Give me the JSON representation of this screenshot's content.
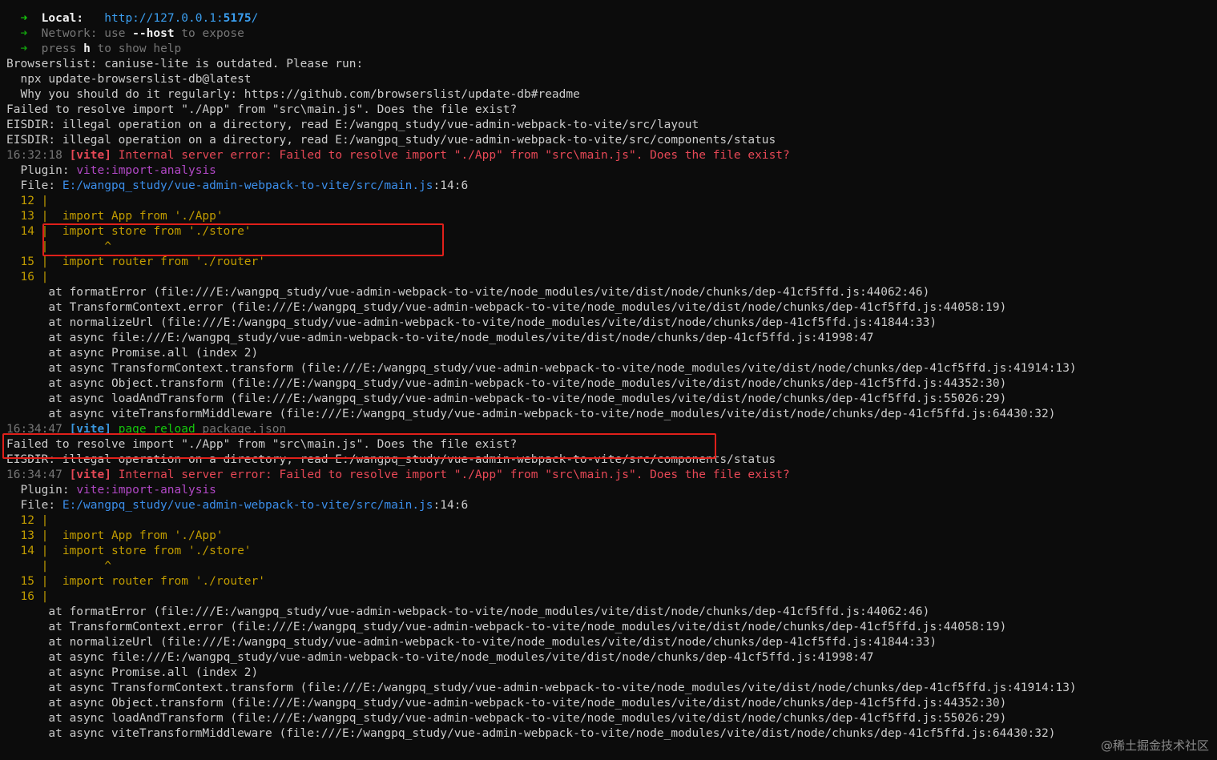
{
  "terminal": {
    "colors": {
      "background": "#0c0c0c",
      "default": "#cccccc",
      "bright_white": "#f2f2f2",
      "green": "#16c60c",
      "url": "#3b9ff0",
      "error_red": "#e74856",
      "timestamp": "#767676",
      "code_yellow": "#c19c00",
      "plugin_magenta": "#b148c6",
      "file_link": "#3b8eea",
      "highlight_box": "#e0201a"
    },
    "lines": [
      {
        "name": "vite-local-line",
        "segs": [
          [
            "  ",
            "c-text"
          ],
          [
            "➜",
            "c-green"
          ],
          [
            "  ",
            "c-text"
          ],
          [
            "Local:",
            "c-white bold"
          ],
          [
            "   ",
            "c-text"
          ],
          [
            "http://127.0.0.1:",
            "c-cyan"
          ],
          [
            "5175",
            "c-cyan bold"
          ],
          [
            "/",
            "c-cyan"
          ]
        ]
      },
      {
        "name": "vite-network-line",
        "segs": [
          [
            "  ",
            "c-text"
          ],
          [
            "➜",
            "c-dgreen"
          ],
          [
            "  ",
            "c-text"
          ],
          [
            "Network:",
            "c-dim"
          ],
          [
            " use ",
            "c-dim"
          ],
          [
            "--host",
            "c-white bold"
          ],
          [
            " to expose",
            "c-dim"
          ]
        ]
      },
      {
        "name": "vite-help-line",
        "segs": [
          [
            "  ",
            "c-text"
          ],
          [
            "➜",
            "c-dgreen"
          ],
          [
            "  ",
            "c-text"
          ],
          [
            "press ",
            "c-dim"
          ],
          [
            "h",
            "c-white bold"
          ],
          [
            " to show help",
            "c-dim"
          ]
        ]
      },
      {
        "name": "browserslist-line",
        "segs": [
          [
            "Browserslist: caniuse-lite is outdated. Please run:",
            "c-text"
          ]
        ]
      },
      {
        "name": "browserslist-cmd-line",
        "segs": [
          [
            "  npx update-browserslist-db@latest",
            "c-text"
          ]
        ]
      },
      {
        "name": "browserslist-why-line",
        "segs": [
          [
            "  Why you should do it regularly: https://github.com/browserslist/update-db#readme",
            "c-text"
          ]
        ]
      },
      {
        "name": "resolve-error-line",
        "segs": [
          [
            "Failed to resolve import \"./App\" from \"src\\main.js\". Does the file exist?",
            "c-text"
          ]
        ]
      },
      {
        "name": "eisdir-layout-line",
        "segs": [
          [
            "EISDIR: illegal operation on a directory, read E:/wangpq_study/vue-admin-webpack-to-vite/src/layout",
            "c-text"
          ]
        ]
      },
      {
        "name": "eisdir-status-line",
        "segs": [
          [
            "EISDIR: illegal operation on a directory, read E:/wangpq_study/vue-admin-webpack-to-vite/src/components/status",
            "c-text"
          ]
        ]
      },
      {
        "name": "internal-error-line",
        "segs": [
          [
            "16:32:18",
            "c-dim"
          ],
          [
            " ",
            "c-text"
          ],
          [
            "[vite]",
            "c-red bold"
          ],
          [
            " Internal server error: Failed to resolve import \"./App\" from \"src\\main.js\". Does the file exist?",
            "c-red"
          ]
        ]
      },
      {
        "name": "plugin-line",
        "segs": [
          [
            "  Plugin: ",
            "c-text"
          ],
          [
            "vite:import-analysis",
            "c-magenta"
          ]
        ]
      },
      {
        "name": "file-line",
        "segs": [
          [
            "  File: ",
            "c-text"
          ],
          [
            "E:/wangpq_study/vue-admin-webpack-to-vite/src/main.js",
            "c-blue"
          ],
          [
            ":14:6",
            "c-text"
          ]
        ]
      },
      {
        "name": "code-frame-line",
        "segs": [
          [
            "  12 |",
            "c-yellow"
          ]
        ]
      },
      {
        "name": "code-frame-line",
        "segs": [
          [
            "  13 |  import App from './App'",
            "c-yellow"
          ]
        ]
      },
      {
        "name": "code-frame-line",
        "segs": [
          [
            "  14 |  import store from './store'",
            "c-yellow"
          ]
        ]
      },
      {
        "name": "code-frame-line",
        "segs": [
          [
            "     |        ^",
            "c-yellow"
          ]
        ]
      },
      {
        "name": "code-frame-line",
        "segs": [
          [
            "  15 |  import router from './router'",
            "c-yellow"
          ]
        ]
      },
      {
        "name": "code-frame-line",
        "segs": [
          [
            "  16 |",
            "c-yellow"
          ]
        ]
      },
      {
        "name": "stack-trace-line",
        "segs": [
          [
            "      at formatError (file:///E:/wangpq_study/vue-admin-webpack-to-vite/node_modules/vite/dist/node/chunks/dep-41cf5ffd.js:44062:46)",
            "c-text"
          ]
        ]
      },
      {
        "name": "stack-trace-line",
        "segs": [
          [
            "      at TransformContext.error (file:///E:/wangpq_study/vue-admin-webpack-to-vite/node_modules/vite/dist/node/chunks/dep-41cf5ffd.js:44058:19)",
            "c-text"
          ]
        ]
      },
      {
        "name": "stack-trace-line",
        "segs": [
          [
            "      at normalizeUrl (file:///E:/wangpq_study/vue-admin-webpack-to-vite/node_modules/vite/dist/node/chunks/dep-41cf5ffd.js:41844:33)",
            "c-text"
          ]
        ]
      },
      {
        "name": "stack-trace-line",
        "segs": [
          [
            "      at async file:///E:/wangpq_study/vue-admin-webpack-to-vite/node_modules/vite/dist/node/chunks/dep-41cf5ffd.js:41998:47",
            "c-text"
          ]
        ]
      },
      {
        "name": "stack-trace-line",
        "segs": [
          [
            "      at async Promise.all (index 2)",
            "c-text"
          ]
        ]
      },
      {
        "name": "stack-trace-line",
        "segs": [
          [
            "      at async TransformContext.transform (file:///E:/wangpq_study/vue-admin-webpack-to-vite/node_modules/vite/dist/node/chunks/dep-41cf5ffd.js:41914:13)",
            "c-text"
          ]
        ]
      },
      {
        "name": "stack-trace-line",
        "segs": [
          [
            "      at async Object.transform (file:///E:/wangpq_study/vue-admin-webpack-to-vite/node_modules/vite/dist/node/chunks/dep-41cf5ffd.js:44352:30)",
            "c-text"
          ]
        ]
      },
      {
        "name": "stack-trace-line",
        "segs": [
          [
            "      at async loadAndTransform (file:///E:/wangpq_study/vue-admin-webpack-to-vite/node_modules/vite/dist/node/chunks/dep-41cf5ffd.js:55026:29)",
            "c-text"
          ]
        ]
      },
      {
        "name": "stack-trace-line",
        "segs": [
          [
            "      at async viteTransformMiddleware (file:///E:/wangpq_study/vue-admin-webpack-to-vite/node_modules/vite/dist/node/chunks/dep-41cf5ffd.js:64430:32)",
            "c-text"
          ]
        ]
      },
      {
        "name": "page-reload-line",
        "segs": [
          [
            "16:34:47",
            "c-dim"
          ],
          [
            " ",
            "c-text"
          ],
          [
            "[vite]",
            "c-teal bold"
          ],
          [
            " ",
            "c-text"
          ],
          [
            "page reload",
            "c-lgreen"
          ],
          [
            " package.json",
            "c-dim"
          ]
        ]
      },
      {
        "name": "resolve-error-line",
        "segs": [
          [
            "Failed to resolve import \"./App\" from \"src\\main.js\". Does the file exist?",
            "c-text"
          ]
        ]
      },
      {
        "name": "eisdir-status-line",
        "segs": [
          [
            "EISDIR: illegal operation on a directory, read E:/wangpq_study/vue-admin-webpack-to-vite/src/components/status",
            "c-text"
          ]
        ]
      },
      {
        "name": "internal-error-line",
        "segs": [
          [
            "16:34:47",
            "c-dim"
          ],
          [
            " ",
            "c-text"
          ],
          [
            "[vite]",
            "c-red bold"
          ],
          [
            " Internal server error: Failed to resolve import \"./App\" from \"src\\main.js\". Does the file exist?",
            "c-red"
          ]
        ]
      },
      {
        "name": "plugin-line",
        "segs": [
          [
            "  Plugin: ",
            "c-text"
          ],
          [
            "vite:import-analysis",
            "c-magenta"
          ]
        ]
      },
      {
        "name": "file-line",
        "segs": [
          [
            "  File: ",
            "c-text"
          ],
          [
            "E:/wangpq_study/vue-admin-webpack-to-vite/src/main.js",
            "c-blue"
          ],
          [
            ":14:6",
            "c-text"
          ]
        ]
      },
      {
        "name": "code-frame-line",
        "segs": [
          [
            "  12 |",
            "c-yellow"
          ]
        ]
      },
      {
        "name": "code-frame-line",
        "segs": [
          [
            "  13 |  import App from './App'",
            "c-yellow"
          ]
        ]
      },
      {
        "name": "code-frame-line",
        "segs": [
          [
            "  14 |  import store from './store'",
            "c-yellow"
          ]
        ]
      },
      {
        "name": "code-frame-line",
        "segs": [
          [
            "     |        ^",
            "c-yellow"
          ]
        ]
      },
      {
        "name": "code-frame-line",
        "segs": [
          [
            "  15 |  import router from './router'",
            "c-yellow"
          ]
        ]
      },
      {
        "name": "code-frame-line",
        "segs": [
          [
            "  16 |",
            "c-yellow"
          ]
        ]
      },
      {
        "name": "stack-trace-line",
        "segs": [
          [
            "      at formatError (file:///E:/wangpq_study/vue-admin-webpack-to-vite/node_modules/vite/dist/node/chunks/dep-41cf5ffd.js:44062:46)",
            "c-text"
          ]
        ]
      },
      {
        "name": "stack-trace-line",
        "segs": [
          [
            "      at TransformContext.error (file:///E:/wangpq_study/vue-admin-webpack-to-vite/node_modules/vite/dist/node/chunks/dep-41cf5ffd.js:44058:19)",
            "c-text"
          ]
        ]
      },
      {
        "name": "stack-trace-line",
        "segs": [
          [
            "      at normalizeUrl (file:///E:/wangpq_study/vue-admin-webpack-to-vite/node_modules/vite/dist/node/chunks/dep-41cf5ffd.js:41844:33)",
            "c-text"
          ]
        ]
      },
      {
        "name": "stack-trace-line",
        "segs": [
          [
            "      at async file:///E:/wangpq_study/vue-admin-webpack-to-vite/node_modules/vite/dist/node/chunks/dep-41cf5ffd.js:41998:47",
            "c-text"
          ]
        ]
      },
      {
        "name": "stack-trace-line",
        "segs": [
          [
            "      at async Promise.all (index 2)",
            "c-text"
          ]
        ]
      },
      {
        "name": "stack-trace-line",
        "segs": [
          [
            "      at async TransformContext.transform (file:///E:/wangpq_study/vue-admin-webpack-to-vite/node_modules/vite/dist/node/chunks/dep-41cf5ffd.js:41914:13)",
            "c-text"
          ]
        ]
      },
      {
        "name": "stack-trace-line",
        "segs": [
          [
            "      at async Object.transform (file:///E:/wangpq_study/vue-admin-webpack-to-vite/node_modules/vite/dist/node/chunks/dep-41cf5ffd.js:44352:30)",
            "c-text"
          ]
        ]
      },
      {
        "name": "stack-trace-line",
        "segs": [
          [
            "      at async loadAndTransform (file:///E:/wangpq_study/vue-admin-webpack-to-vite/node_modules/vite/dist/node/chunks/dep-41cf5ffd.js:55026:29)",
            "c-text"
          ]
        ]
      },
      {
        "name": "stack-trace-line",
        "segs": [
          [
            "      at async viteTransformMiddleware (file:///E:/wangpq_study/vue-admin-webpack-to-vite/node_modules/vite/dist/node/chunks/dep-41cf5ffd.js:64430:32)",
            "c-text"
          ]
        ]
      }
    ]
  },
  "watermark": "@稀土掘金技术社区"
}
